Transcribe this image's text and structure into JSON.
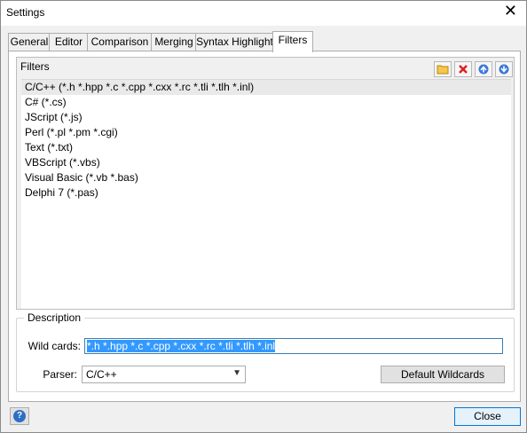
{
  "window": {
    "title": "Settings"
  },
  "tabs": [
    {
      "label": "General"
    },
    {
      "label": "Editor"
    },
    {
      "label": "Comparison"
    },
    {
      "label": "Merging"
    },
    {
      "label": "Syntax Highlight"
    },
    {
      "label": "Filters"
    }
  ],
  "filters": {
    "group_title": "Filters",
    "toolbar_icons": [
      "folder-icon",
      "delete-icon",
      "arrow-up-icon",
      "arrow-down-icon"
    ],
    "items": [
      "C/C++ (*.h *.hpp *.c *.cpp *.cxx *.rc *.tli *.tlh *.inl)",
      "C# (*.cs)",
      "JScript (*.js)",
      "Perl (*.pl *.pm *.cgi)",
      "Text (*.txt)",
      "VBScript (*.vbs)",
      "Visual Basic (*.vb *.bas)",
      "Delphi 7 (*.pas)"
    ]
  },
  "description": {
    "title": "Description",
    "wildcards_label": "Wild cards:",
    "wildcards_value": "*.h *.hpp *.c *.cpp *.cxx *.rc *.tli *.tlh *.inl",
    "parser_label": "Parser:",
    "parser_value": "C/C++",
    "default_button": "Default Wildcards"
  },
  "footer": {
    "close_label": "Close"
  }
}
